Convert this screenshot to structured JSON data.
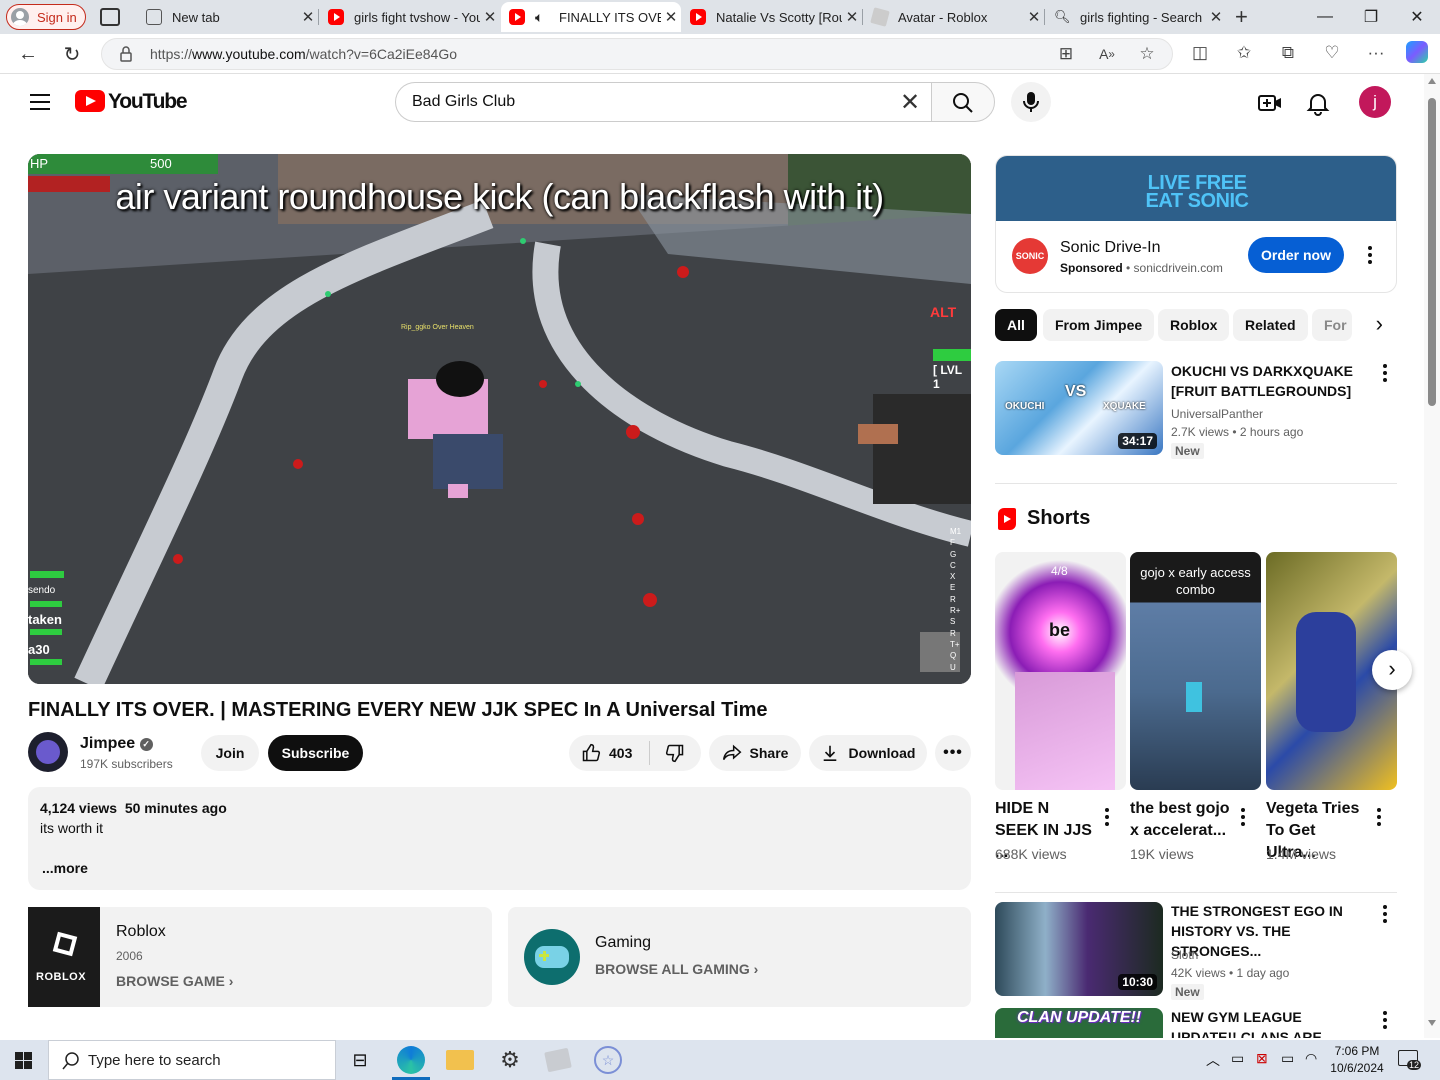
{
  "browser": {
    "signin_label": "Sign in",
    "tabs": [
      {
        "label": "New tab",
        "icon": "newtab-icon"
      },
      {
        "label": "girls fight tvshow - You",
        "icon": "youtube-icon"
      },
      {
        "label": "FINALLY ITS OVER",
        "icon": "youtube-icon"
      },
      {
        "label": "Natalie Vs Scotty [Roun",
        "icon": "youtube-icon"
      },
      {
        "label": "Avatar - Roblox",
        "icon": "roblox-icon"
      },
      {
        "label": "girls fighting - Search",
        "icon": "search-icon"
      }
    ],
    "url_prefix": "https://",
    "url_host": "www.youtube.com",
    "url_path": "/watch?v=6Ca2iEe84Go"
  },
  "youtube": {
    "logo_text": "YouTube",
    "search_value": "Bad Girls Club",
    "avatar_letter": "j"
  },
  "video": {
    "caption": "air variant roundhouse kick (can blackflash with it)",
    "hud": {
      "hp_label": "HP",
      "hp_value": "500",
      "alt": "ALT",
      "lvl": "[ LVL 1",
      "nametag": "Rip_ggko Over Heaven",
      "left_stats": [
        "sendo",
        "taken",
        "a30"
      ],
      "right_keys": [
        "M1",
        "F",
        "G",
        "C",
        "X",
        "E",
        "R",
        "R+",
        "S",
        "R",
        "T+",
        "Q",
        "U"
      ]
    },
    "title": "FINALLY ITS OVER. | MASTERING EVERY NEW JJK SPEC In A Universal Time",
    "channel_name": "Jimpee",
    "subscribers": "197K subscribers",
    "join_label": "Join",
    "subscribe_label": "Subscribe",
    "likes": "403",
    "share_label": "Share",
    "download_label": "Download",
    "views": "4,124 views",
    "posted": "50 minutes ago",
    "description": "its worth it",
    "more_label": "...more",
    "game_card": {
      "name": "Roblox",
      "year": "2006",
      "link": "BROWSE GAME",
      "logo_text": "ROBLOX"
    },
    "gaming_card": {
      "name": "Gaming",
      "link": "BROWSE ALL GAMING"
    }
  },
  "ad": {
    "banner_line1": "LIVE FREE",
    "banner_line2": "EAT SONIC",
    "logo_text": "SONIC",
    "name": "Sonic Drive-In",
    "sponsored": "Sponsored",
    "domain": "sonicdrivein.com",
    "cta": "Order now"
  },
  "chips": [
    "All",
    "From Jimpee",
    "Roblox",
    "Related",
    "For"
  ],
  "recommended": [
    {
      "title": "OKUCHI VS DARKXQUAKE [FRUIT BATTLEGROUNDS]",
      "channel": "UniversalPanther",
      "meta": "2.7K views • 2 hours ago",
      "duration": "34:17",
      "badge": "New",
      "thumb_text": [
        "OKUCHI",
        "XQUAKE",
        "VS"
      ]
    },
    {
      "title": "THE STRONGEST EGO IN HISTORY VS. THE STRONGES...",
      "channel": "Sloth",
      "meta": "42K views • 1 day ago",
      "duration": "10:30",
      "badge": "New"
    },
    {
      "title": "NEW GYM LEAGUE UPDATE!! CLANS ARE FINALLY HERE!!",
      "thumb_text": "CLAN UPDATE!!"
    }
  ],
  "shorts": {
    "heading": "Shorts",
    "items": [
      {
        "title": "HIDE N SEEK IN JJS ...",
        "views": "688K views",
        "overlay": "4/8",
        "word": "be"
      },
      {
        "title": "the best gojo x accelerat...",
        "views": "19K views",
        "overlay": "gojo x early access combo"
      },
      {
        "title": "Vegeta Tries To Get Ultra...",
        "views": "1.4M views"
      }
    ]
  },
  "taskbar": {
    "search_placeholder": "Type here to search",
    "time": "7:06 PM",
    "date": "10/6/2024",
    "notif_count": "12"
  },
  "colors": {
    "youtube_red": "#ff0000",
    "subscribe_black": "#0f0f0f",
    "ad_blue": "#065fd4",
    "sonic_banner": "#2d5f8a",
    "avatar_pink": "#c2185b"
  }
}
